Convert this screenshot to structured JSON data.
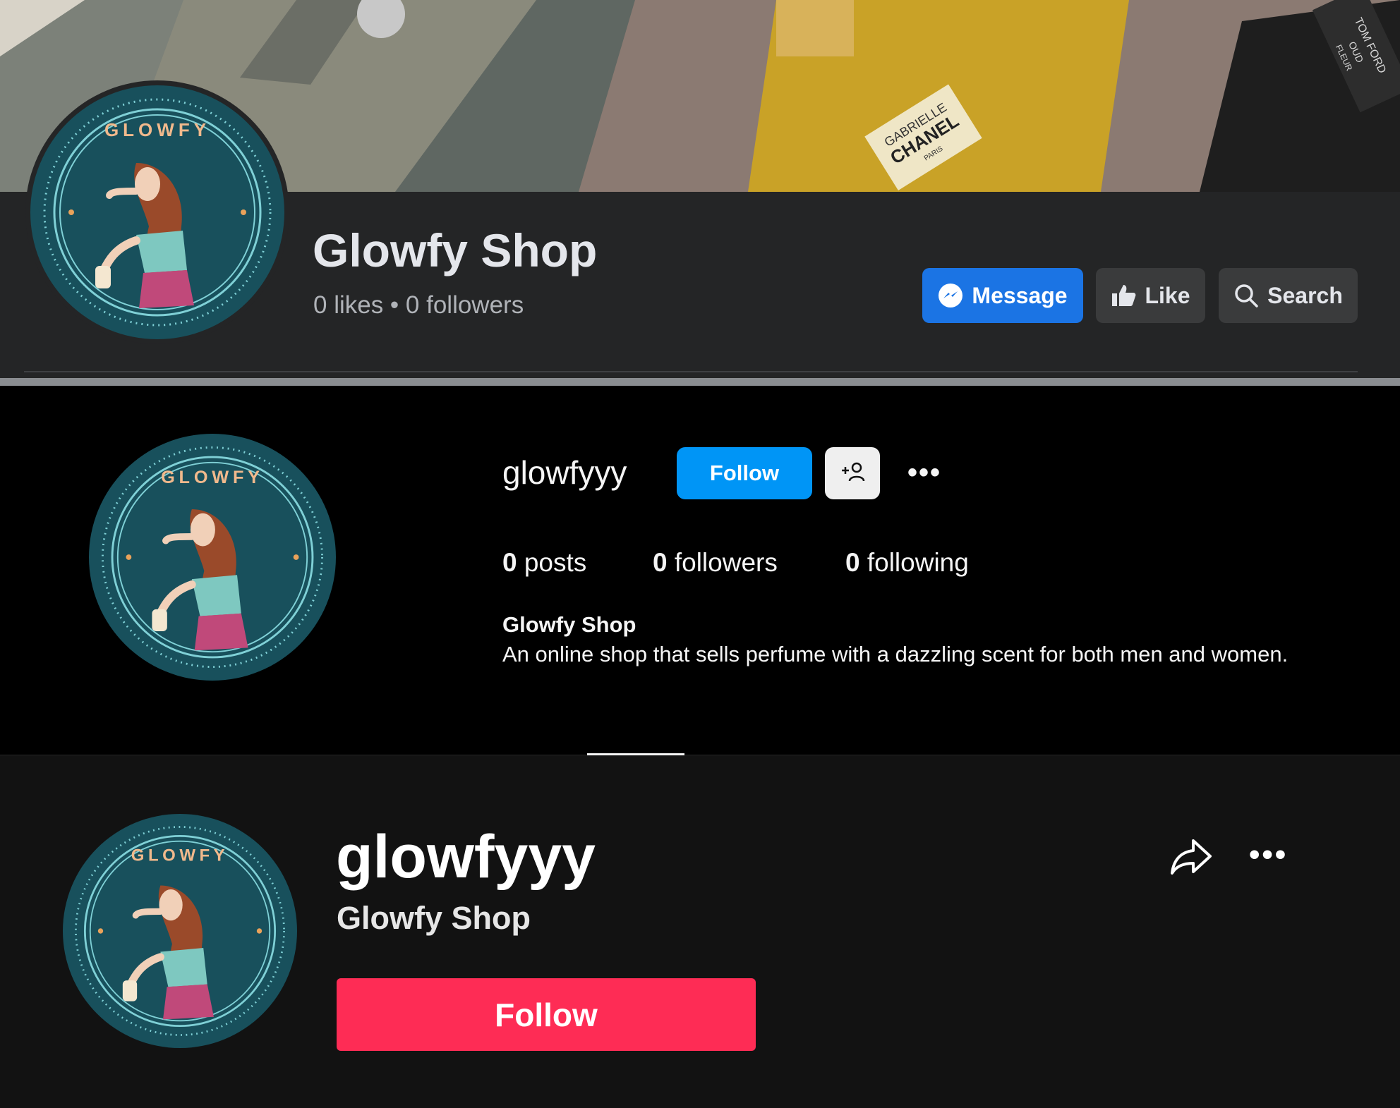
{
  "cover": {
    "bottle_labels": [
      "GABRIELLE",
      "CHANEL",
      "PARIS",
      "TOM FORD",
      "OUD",
      "FLEUR"
    ],
    "colors": {
      "stone": "#6b706b",
      "marble": "#8b7a72",
      "perfume": "#c9a227"
    }
  },
  "logo": {
    "wordmark": "GLOWFY",
    "colors": {
      "badge": "#18505c",
      "ring": "#7fd0d6",
      "hair": "#9a4a2a",
      "top": "#7ec8c0",
      "skirt": "#c0497a"
    }
  },
  "page_profile": {
    "title": "Glowfy Shop",
    "stats": "0 likes • 0 followers",
    "buttons": {
      "message": "Message",
      "like": "Like",
      "search": "Search"
    },
    "colors": {
      "primary": "#1b74e4",
      "background": "#242526"
    }
  },
  "photo_profile": {
    "username": "glowfyyy",
    "follow_label": "Follow",
    "posts": {
      "count": "0",
      "label": "posts"
    },
    "followers": {
      "count": "0",
      "label": "followers"
    },
    "following": {
      "count": "0",
      "label": "following"
    },
    "display_name": "Glowfy Shop",
    "bio": "An online shop that sells perfume with a dazzling scent for both men and women.",
    "colors": {
      "follow": "#0095f6"
    }
  },
  "video_profile": {
    "username": "glowfyyy",
    "display_name": "Glowfy Shop",
    "follow_label": "Follow",
    "colors": {
      "follow": "#fe2c55"
    }
  }
}
